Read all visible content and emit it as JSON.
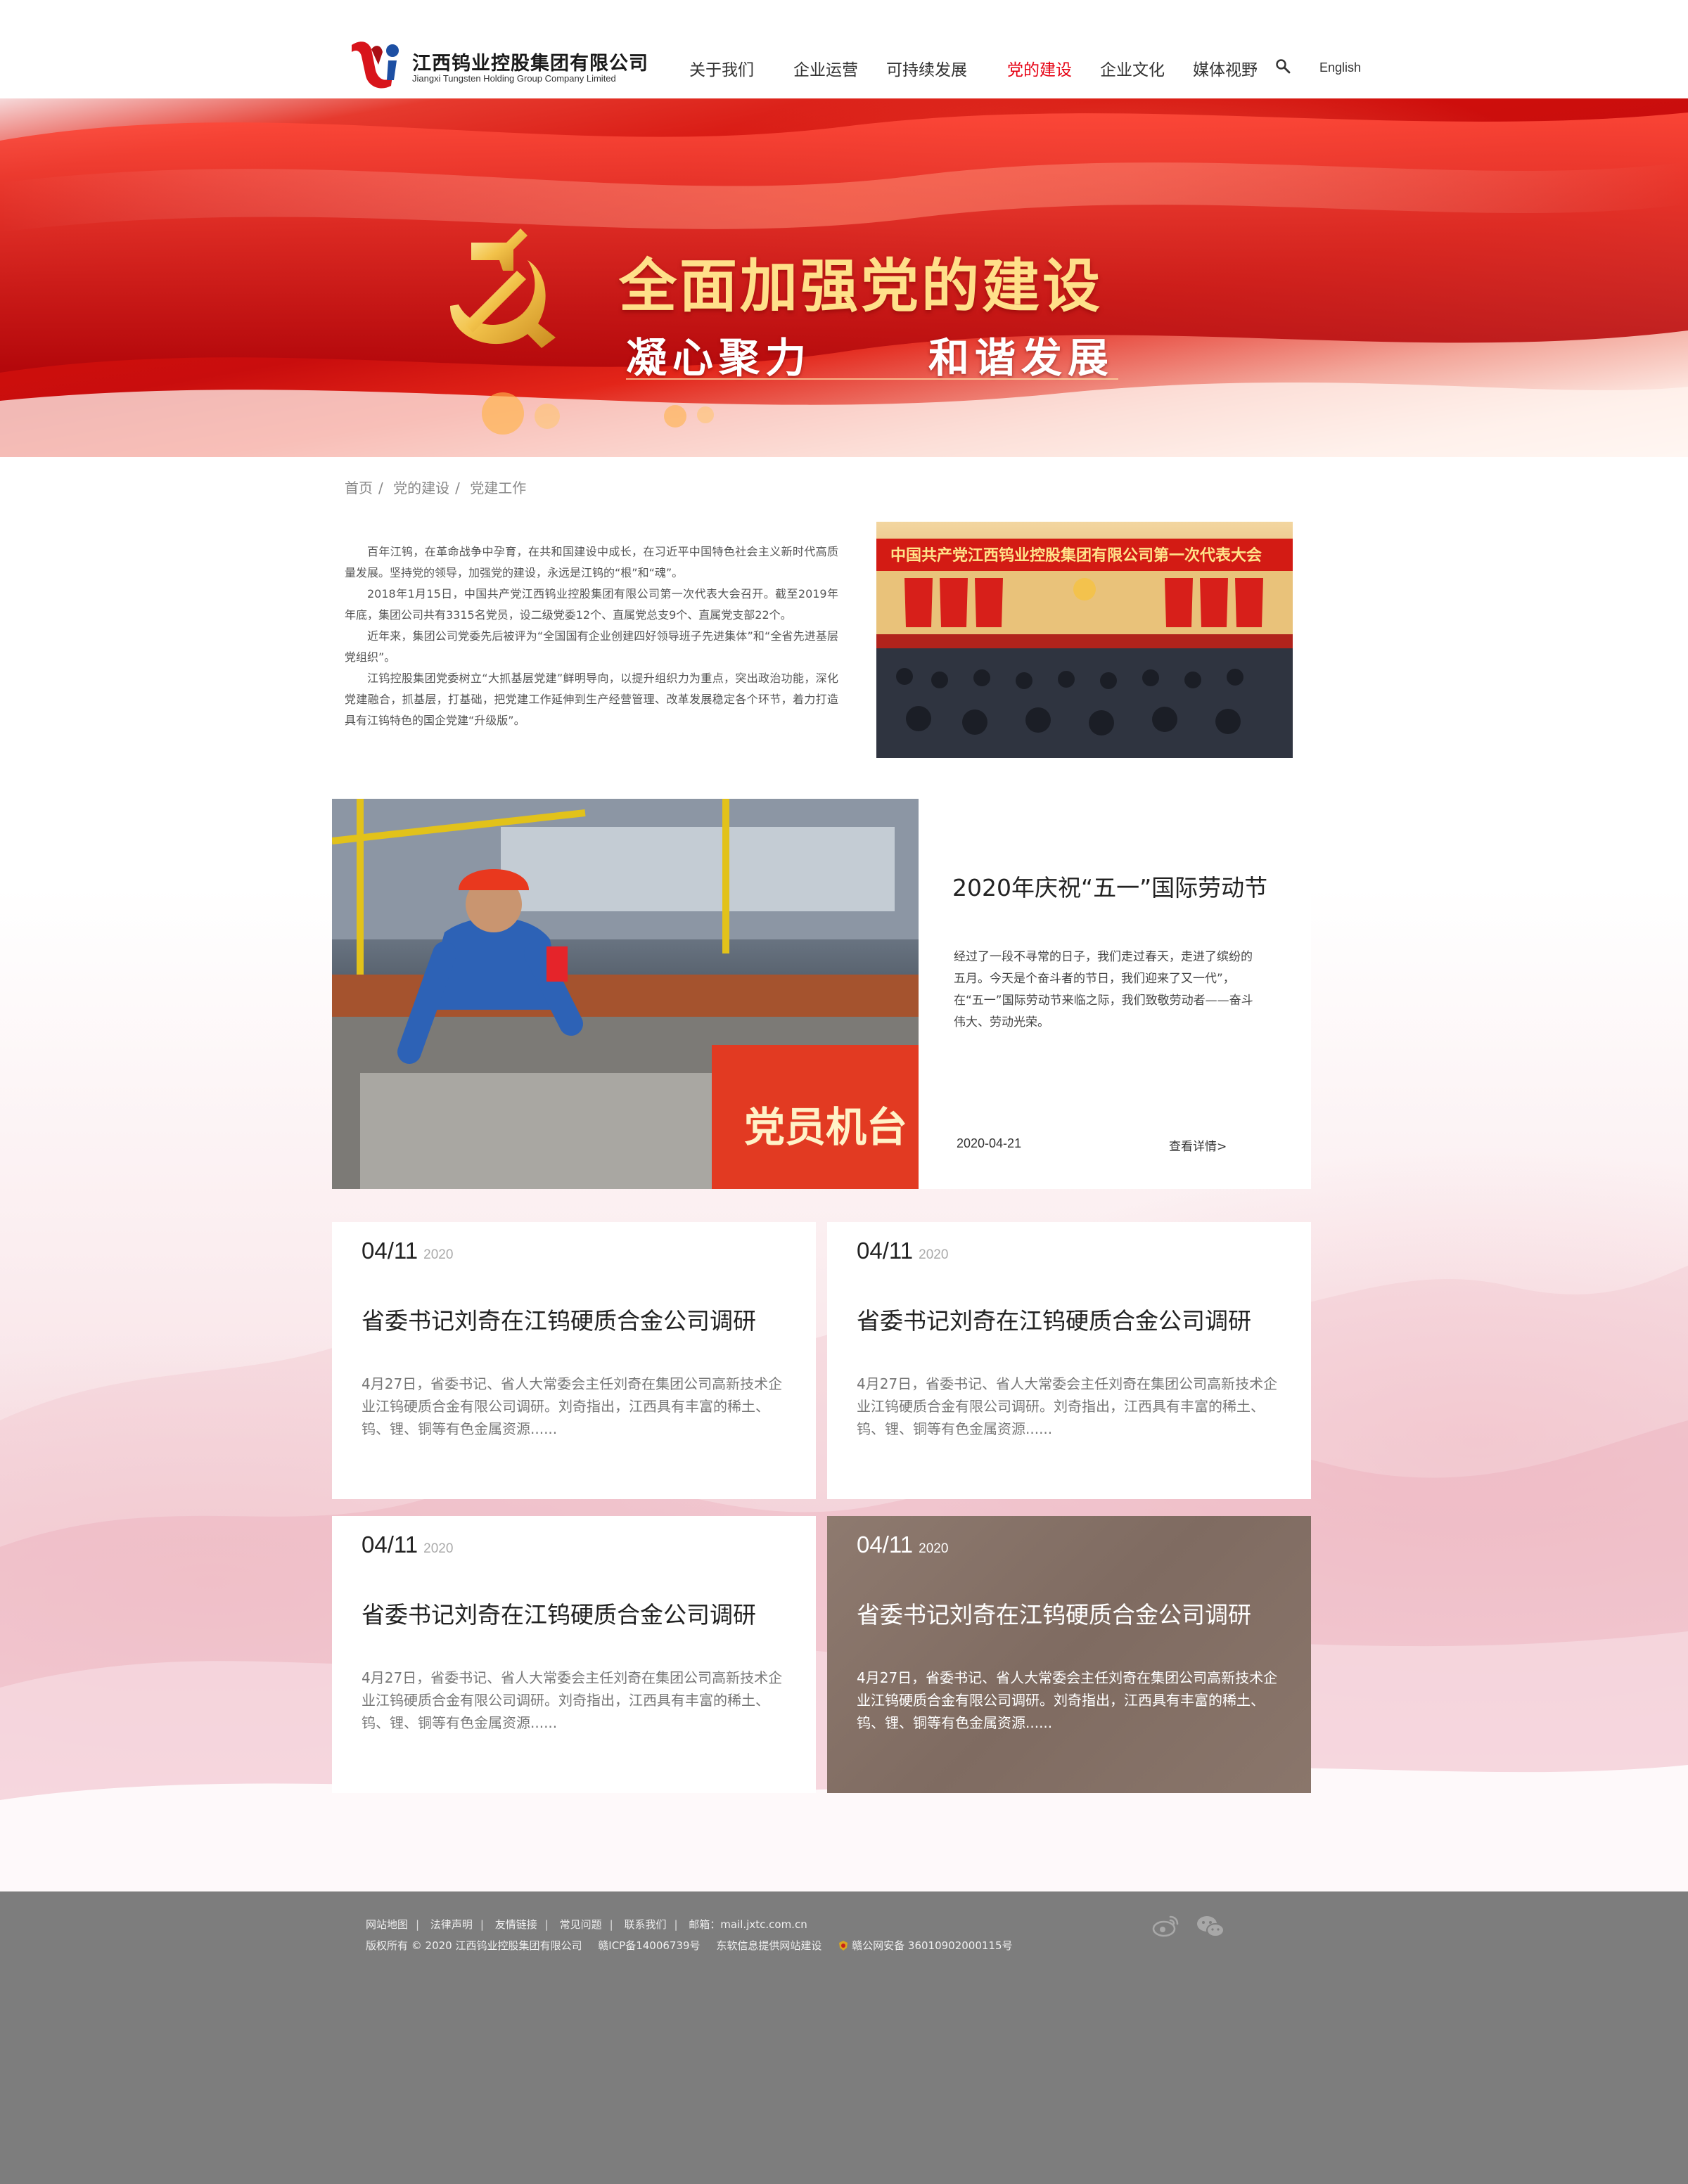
{
  "header": {
    "logo_cn": "江西钨业控股集团有限公司",
    "logo_en": "Jiangxi Tungsten Holding Group Company Limited",
    "nav": [
      {
        "label": "关于我们"
      },
      {
        "label": "企业运营"
      },
      {
        "label": "可持续发展"
      },
      {
        "label": "党的建设",
        "active": true
      },
      {
        "label": "企业文化"
      },
      {
        "label": "媒体视野"
      }
    ],
    "lang": "English",
    "accent_color": "#e60012"
  },
  "banner": {
    "title": "全面加强党的建设",
    "subtitle_left": "凝心聚力",
    "subtitle_right": "和谐发展"
  },
  "breadcrumb": [
    "首页",
    "党的建设",
    "党建工作"
  ],
  "intro": {
    "paragraphs": [
      "百年江钨，在革命战争中孕育，在共和国建设中成长，在习近平中国特色社会主义新时代高质量发展。坚持党的领导，加强党的建设，永远是江钨的“根”和“魂”。",
      "2018年1月15日，中国共产党江西钨业控股集团有限公司第一次代表大会召开。截至2019年年底，集团公司共有3315名党员，设二级党委12个、直属党总支9个、直属党支部22个。",
      "近年来，集团公司党委先后被评为“全国国有企业创建四好领导班子先进集体”和“全省先进基层党组织”。",
      "江钨控股集团党委树立“大抓基层党建”鲜明导向，以提升组织力为重点，突出政治功能，深化党建融合，抓基层，打基础，把党建工作延伸到生产经营管理、改革发展稳定各个环节，着力打造具有江钨特色的国企党建“升级版”。"
    ],
    "photo_caption": "中国共产党江西钨业控股集团有限公司第一次代表大会"
  },
  "featured": {
    "photo_sign": "党员机台",
    "title": "2020年庆祝“五一”国际劳动节",
    "desc": "经过了一段不寻常的日子，我们走过春天，走进了缤纷的五月。今天是个奋斗者的节日，我们迎来了又一代”，在“五一”国际劳动节来临之际，我们致敬劳动者——奋斗伟大、劳动光荣。",
    "date": "2020-04-21",
    "more": "查看详情>"
  },
  "news": [
    {
      "date": "04/11",
      "year": "2020",
      "title": "省委书记刘奇在江钨硬质合金公司调研",
      "desc": "4月27日，省委书记、省人大常委会主任刘奇在集团公司高新技术企业江钨硬质合金有限公司调研。刘奇指出，江西具有丰富的稀土、钨、锂、铜等有色金属资源......"
    },
    {
      "date": "04/11",
      "year": "2020",
      "title": "省委书记刘奇在江钨硬质合金公司调研",
      "desc": "4月27日，省委书记、省人大常委会主任刘奇在集团公司高新技术企业江钨硬质合金有限公司调研。刘奇指出，江西具有丰富的稀土、钨、锂、铜等有色金属资源......"
    },
    {
      "date": "04/11",
      "year": "2020",
      "title": "省委书记刘奇在江钨硬质合金公司调研",
      "desc": "4月27日，省委书记、省人大常委会主任刘奇在集团公司高新技术企业江钨硬质合金有限公司调研。刘奇指出，江西具有丰富的稀土、钨、锂、铜等有色金属资源......"
    },
    {
      "date": "04/11",
      "year": "2020",
      "title": "省委书记刘奇在江钨硬质合金公司调研",
      "desc": "4月27日，省委书记、省人大常委会主任刘奇在集团公司高新技术企业江钨硬质合金有限公司调研。刘奇指出，江西具有丰富的稀土、钨、锂、铜等有色金属资源......",
      "highlight": true
    }
  ],
  "footer": {
    "links": [
      "网站地图",
      "法律声明",
      "友情链接",
      "常见问题",
      "联系我们"
    ],
    "email": "邮箱：mail.jxtc.com.cn",
    "copyright": "版权所有 © 2020 江西钨业控股集团有限公司",
    "icp": "赣ICP备14006739号",
    "builder": "东软信息提供网站建设",
    "police": "赣公网安备 36010902000115号",
    "bg_color": "#7d7d7d"
  }
}
